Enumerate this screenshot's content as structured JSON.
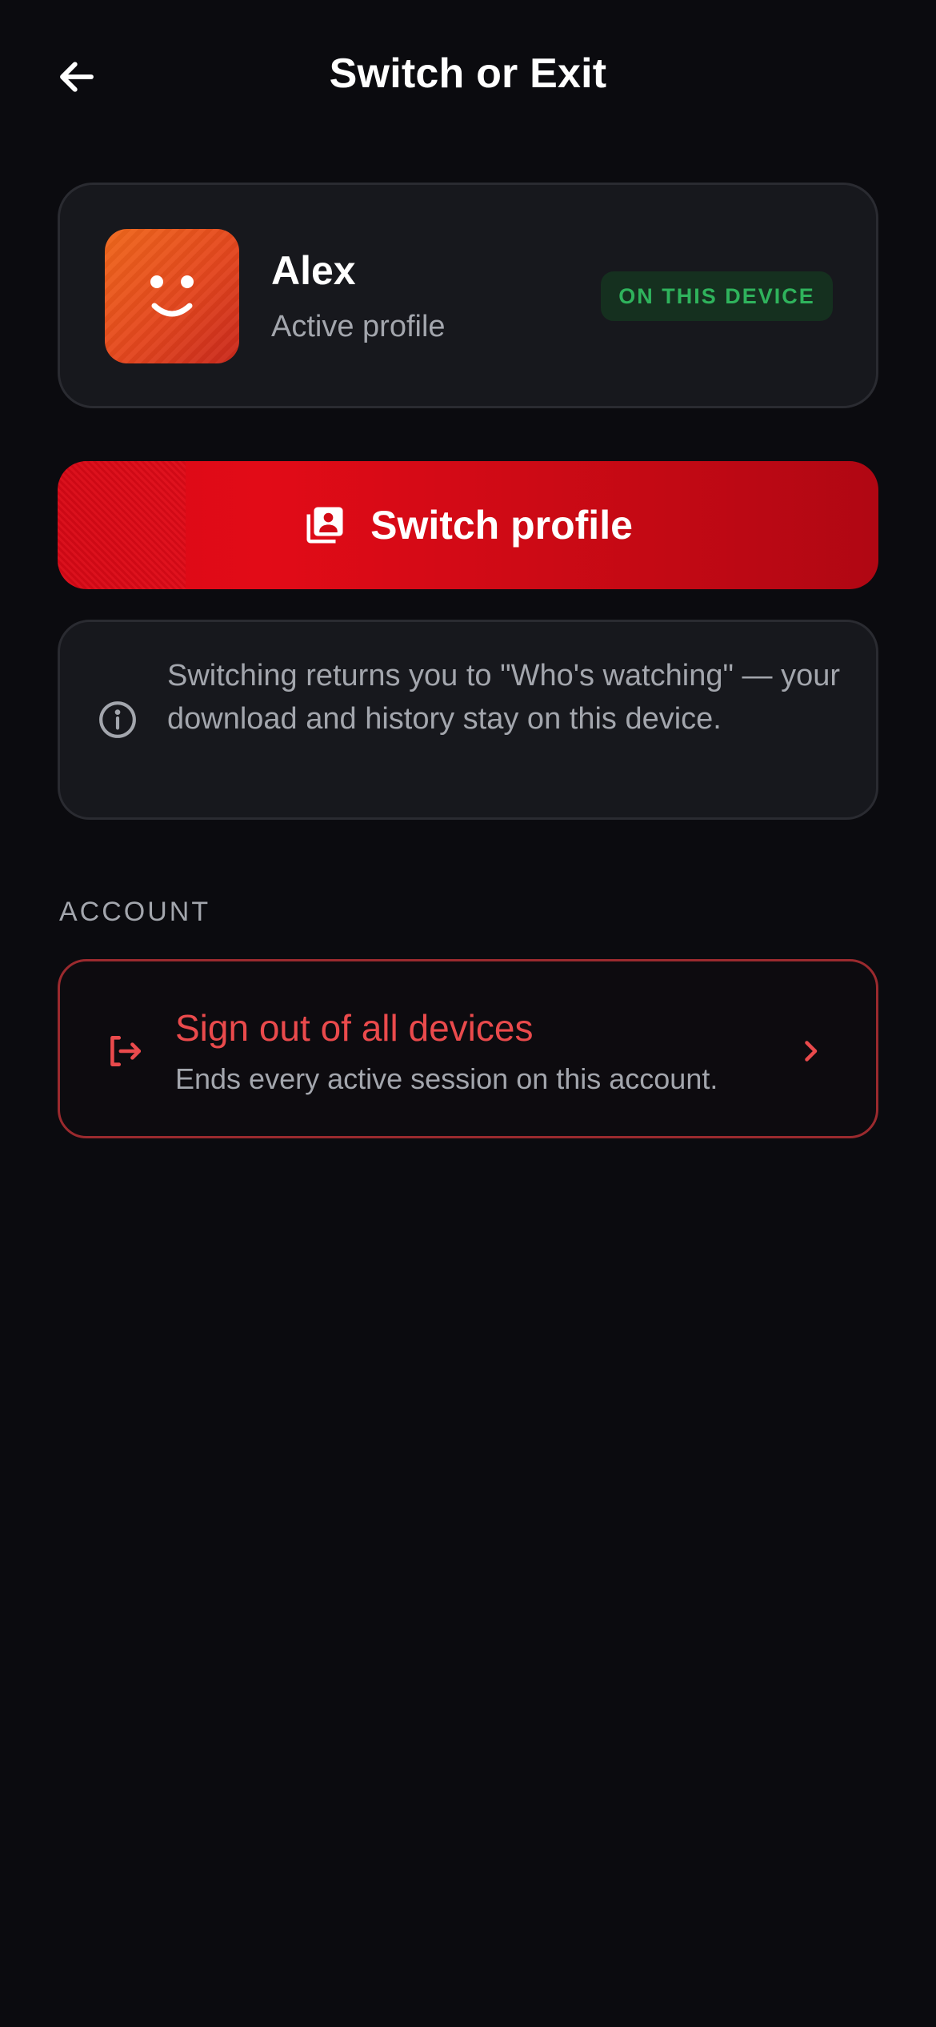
{
  "header": {
    "title": "Switch or Exit",
    "back_icon": "arrow-left-icon"
  },
  "profile": {
    "name": "Alex",
    "subtitle": "Active profile",
    "badge": "ON THIS DEVICE",
    "avatar_icon": "smiley-face-icon",
    "avatar_color": "#e4471e"
  },
  "switch_button": {
    "label": "Switch profile",
    "icon": "profiles-stack-icon",
    "color": "#d90916"
  },
  "info": {
    "icon": "info-circle-icon",
    "text": "Switching returns you to \"Who's watching\" — your download and history stay on this device."
  },
  "account_section": {
    "label": "ACCOUNT",
    "signout": {
      "title": "Sign out of all devices",
      "subtitle": "Ends every active session on this account.",
      "icon": "logout-icon",
      "chevron_icon": "chevron-right-icon",
      "color": "#ea4a4c"
    }
  }
}
